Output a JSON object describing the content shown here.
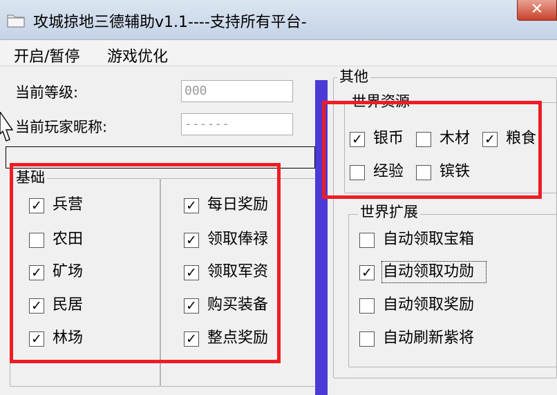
{
  "window": {
    "title": "攻城掠地三德辅助v1.1----支持所有平台-",
    "close_glyph": "✕"
  },
  "menu": {
    "items": [
      "开启/暂停",
      "游戏优化"
    ]
  },
  "info": {
    "level_label": "当前等级:",
    "level_value": "000",
    "nickname_label": "当前玩家昵称:",
    "nickname_value": "------"
  },
  "basic": {
    "title": "基础",
    "left_items": [
      {
        "label": "兵营",
        "checked": true
      },
      {
        "label": "农田",
        "checked": false
      },
      {
        "label": "矿场",
        "checked": true
      },
      {
        "label": "民居",
        "checked": true
      },
      {
        "label": "林场",
        "checked": true
      }
    ],
    "right_items": [
      {
        "label": "每日奖励",
        "checked": true
      },
      {
        "label": "领取俸禄",
        "checked": true
      },
      {
        "label": "领取军资",
        "checked": true
      },
      {
        "label": "购买装备",
        "checked": true
      },
      {
        "label": "整点奖励",
        "checked": true
      }
    ]
  },
  "other": {
    "title": "其他",
    "resources": {
      "title": "世界资源",
      "items": [
        {
          "label": "银币",
          "checked": true
        },
        {
          "label": "木材",
          "checked": false
        },
        {
          "label": "粮食",
          "checked": true
        },
        {
          "label": "经验",
          "checked": false
        },
        {
          "label": "镔铁",
          "checked": false
        }
      ]
    },
    "expand": {
      "title": "世界扩展",
      "items": [
        {
          "label": "自动领取宝箱",
          "checked": false
        },
        {
          "label": "自动领取功勋",
          "checked": true
        },
        {
          "label": "自动领取奖励",
          "checked": false
        },
        {
          "label": "自动刷新紫将",
          "checked": false
        }
      ]
    }
  },
  "colors": {
    "annotation": "#ee1c24",
    "divider": "#4b3ad6",
    "close": "#c8412a"
  },
  "check_glyph": "✓"
}
